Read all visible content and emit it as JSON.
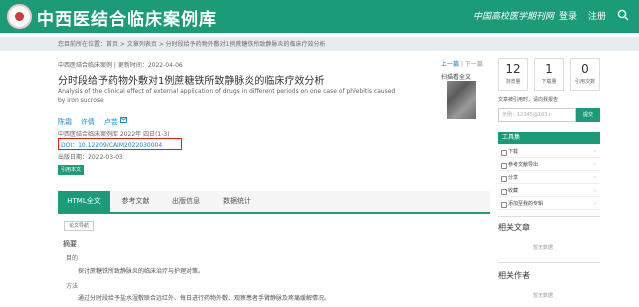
{
  "header": {
    "site_title": "中西医结合临床案例库",
    "nav": [
      "中国高校医学期刊网",
      "登录",
      "注册"
    ],
    "colors": {
      "brand": "#1b9b78",
      "accent_link": "#1b7fcf",
      "doi_highlight": "#e02020"
    }
  },
  "breadcrumb": "您目前所在位置：首页 > 文章列表页 > 分时段给予药物外敷对1例蔗糖铁所致静脉炎的临床疗效分析",
  "article": {
    "meta": "中西医结合临床案例 | 更新时间：2022-04-06",
    "prev_next": {
      "prev": "上一篇",
      "sep": "|",
      "next": "下一篇"
    },
    "title": "分时段给予药物外敷对1例蔗糖铁所致静脉炎的临床疗效分析",
    "title_en": "Analysis of the clinical effect of external application of drugs in different periods on one case of phlebitis caused by iron sucrose",
    "authors": [
      "陈霜",
      "许倩",
      "卢芸"
    ],
    "journal": "中西医结合临床案例库 2022年 四日(1-3)",
    "doi": "DOI：10.12209/CAIM2022030004",
    "pub_date": "出版日期：2022-03-03",
    "cite_label": "引用本文",
    "qr_label": "扫描看全文"
  },
  "tabs": [
    "HTML全文",
    "参考文献",
    "出版信息",
    "数据统计"
  ],
  "content": {
    "nav_chip": "论文导航",
    "abstract_title": "摘要",
    "purpose_label": "目的",
    "purpose_text": "探讨蔗糖铁所致静脉炎的临床治疗与护理对策。",
    "method_label": "方法",
    "method_text": "通过分时段给予盐水湿敷联合远红外、每日进行药物外敷、观察患者手臂静脉及疼痛缓解情况。"
  },
  "sidebar": {
    "stats": [
      {
        "value": "12",
        "label": "浏览量"
      },
      {
        "value": "1",
        "label": "下载量"
      },
      {
        "value": "0",
        "label": "引用次数"
      }
    ],
    "email_label": "文章被引用时，请向我报告",
    "email_placeholder": "示例：12345@163.c",
    "email_btn": "提交",
    "tools_title": "工具集",
    "tools": [
      "下载",
      "参考文献导出",
      "分享",
      "收藏",
      "添加至我的专辑"
    ],
    "related_articles": "相关文章",
    "related_authors": "相关作者",
    "none_text": "暂无数据"
  }
}
